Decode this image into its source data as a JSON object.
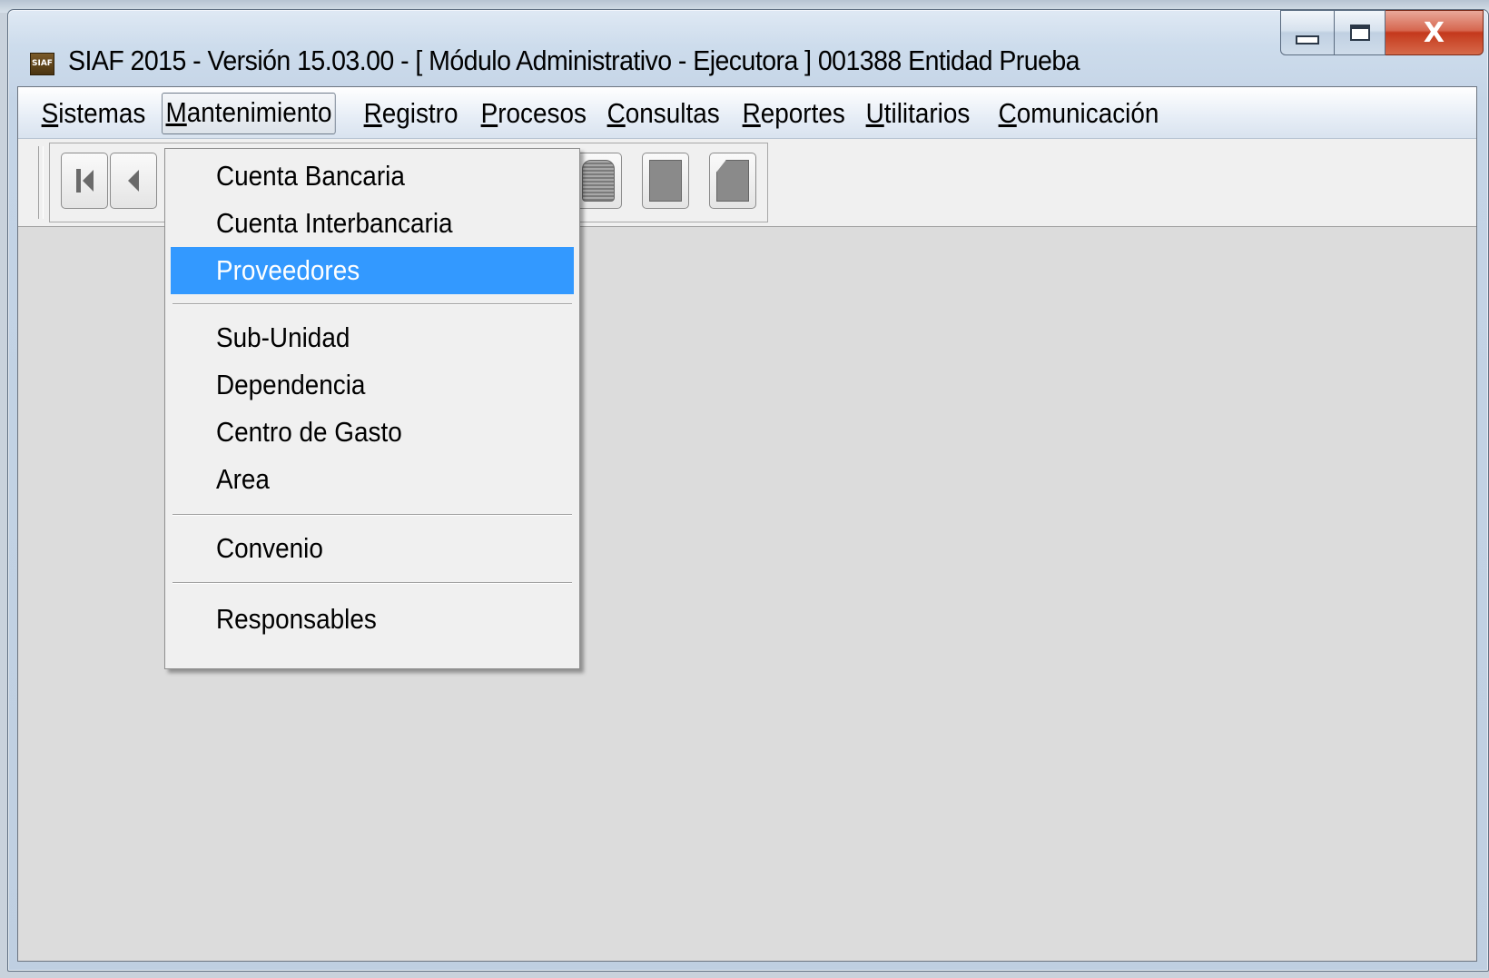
{
  "window": {
    "title": "SIAF 2015 - Versión 15.03.00 - [ Módulo Administrativo - Ejecutora ] 001388 Entidad Prueba",
    "app_icon_text": "SIAF",
    "close_glyph": "X"
  },
  "menubar": {
    "items": [
      {
        "key": "S",
        "rest": "istemas"
      },
      {
        "key": "M",
        "rest": "antenimiento"
      },
      {
        "key": "R",
        "rest": "egistro"
      },
      {
        "key": "P",
        "rest": "rocesos"
      },
      {
        "key": "C",
        "rest": "onsultas"
      },
      {
        "key": "R",
        "rest": "eportes"
      },
      {
        "key": "U",
        "rest": "tilitarios"
      },
      {
        "key": "C",
        "rest": "omunicación"
      }
    ],
    "active_index": 1
  },
  "dropdown": {
    "items": [
      "Cuenta Bancaria",
      "Cuenta Interbancaria",
      "Proveedores",
      "Sub-Unidad",
      "Dependencia",
      "Centro de Gasto",
      "Area",
      "Convenio",
      "Responsables"
    ],
    "highlighted": "Proveedores"
  },
  "colors": {
    "highlight": "#3399ff",
    "workspace": "#dcdcdc"
  }
}
